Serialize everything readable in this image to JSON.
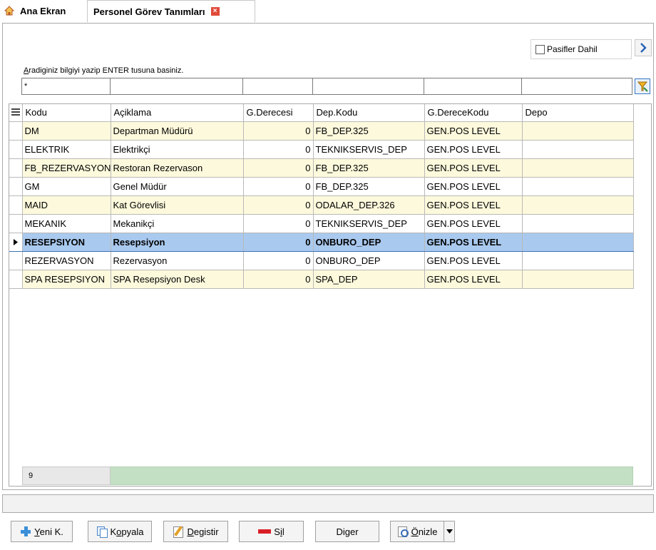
{
  "tabs": [
    {
      "label": "Ana Ekran",
      "icon": "home-icon"
    },
    {
      "label": "Personel Görev Tanımları",
      "active": true,
      "close_icon": "close-icon"
    }
  ],
  "toolbar": {
    "include_passive_label": "Pasifler Dahil",
    "include_passive_checked": false,
    "next_icon": "chevron-right-icon"
  },
  "search": {
    "hint": "Aradiginiz bilgiyi yazip ENTER tusuna basiniz.",
    "filter_values": [
      "*",
      "",
      "",
      "",
      "",
      ""
    ],
    "clear_filter_icon": "filter-clear-icon"
  },
  "grid": {
    "columns": [
      "Kodu",
      "Açiklama",
      "G.Derecesi",
      "Dep.Kodu",
      "G.DereceKodu",
      "Depo"
    ],
    "rows": [
      [
        "DM",
        "Departman Müdürü",
        "0",
        "FB_DEP.325",
        "GEN.POS LEVEL",
        ""
      ],
      [
        "ELEKTRIK",
        "Elektrikçi",
        "0",
        "TEKNIKSERVIS_DEP",
        "GEN.POS LEVEL",
        ""
      ],
      [
        "FB_REZERVASYON",
        "Restoran Rezervason",
        "0",
        "FB_DEP.325",
        "GEN.POS LEVEL",
        ""
      ],
      [
        "GM",
        "Genel Müdür",
        "0",
        "FB_DEP.325",
        "GEN.POS LEVEL",
        ""
      ],
      [
        "MAID",
        "Kat Görevlisi",
        "0",
        "ODALAR_DEP.326",
        "GEN.POS LEVEL",
        ""
      ],
      [
        "MEKANIK",
        "Mekanikçi",
        "0",
        "TEKNIKSERVIS_DEP",
        "GEN.POS LEVEL",
        ""
      ],
      [
        "RESEPSIYON",
        "Resepsiyon",
        "0",
        "ONBURO_DEP",
        "GEN.POS LEVEL",
        ""
      ],
      [
        "REZERVASYON",
        "Rezervasyon",
        "0",
        "ONBURO_DEP",
        "GEN.POS LEVEL",
        ""
      ],
      [
        "SPA RESEPSIYON",
        "SPA Resepsiyon Desk",
        "0",
        "SPA_DEP",
        "GEN.POS LEVEL",
        ""
      ]
    ],
    "selected_row": 6,
    "record_count": "9"
  },
  "buttons": {
    "new": "Yeni K.",
    "copy": "Kopyala",
    "edit": "Degistir",
    "delete": "Sil",
    "other": "Diger",
    "preview": "Önizle"
  },
  "colors": {
    "selected_row": "#a9c9ee",
    "alt_row": "#fdf9dc",
    "footer_bar": "#c4e0c4",
    "delete_icon": "#d91f26",
    "add_icon": "#3a8fd8"
  }
}
